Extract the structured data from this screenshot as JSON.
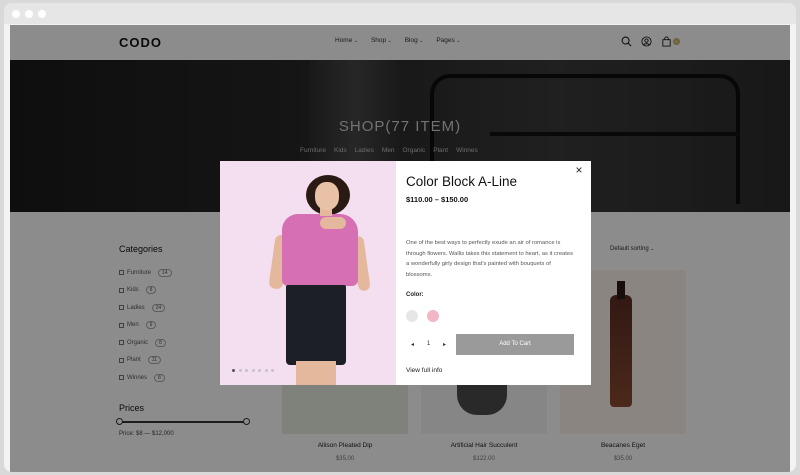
{
  "nav": {
    "logo": "CODO",
    "menu": [
      "Home",
      "Shop",
      "Blog",
      "Pages"
    ],
    "cart_count": "0",
    "icons": [
      "search-icon",
      "user-icon",
      "bag-icon"
    ]
  },
  "hero": {
    "title": "SHOP(77 ITEM)",
    "categories": [
      "Furniture",
      "Kids",
      "Ladies",
      "Men",
      "Organic",
      "Plant",
      "Winnes"
    ]
  },
  "sidebar": {
    "categories_title": "Categories",
    "categories": [
      {
        "label": "Furniture",
        "count": "14"
      },
      {
        "label": "Kids",
        "count": "8"
      },
      {
        "label": "Ladies",
        "count": "24"
      },
      {
        "label": "Men",
        "count": "9"
      },
      {
        "label": "Organic",
        "count": "8"
      },
      {
        "label": "Plant",
        "count": "11"
      },
      {
        "label": "Winnes",
        "count": "8"
      }
    ],
    "prices_title": "Prices",
    "price_range": "Price: $8 — $12,000"
  },
  "sort": {
    "selected": "Default sorting"
  },
  "products": [
    {
      "name": "Allison Pleated Dip",
      "price": "$35.00"
    },
    {
      "name": "Artificial Hair Succulent",
      "price": "$122.00"
    },
    {
      "name": "Beacanes Eget",
      "price": "$35.00"
    }
  ],
  "modal": {
    "title": "Color Block A-Line",
    "price": "$110.00 – $150.00",
    "description": "One of the best ways to perfectly exude an air of romance is through flowers. Wallis takes this statement to heart, as it creates a wonderfully girly design that's painted with bouquets of blossoms.",
    "color_label": "Color:",
    "swatches": [
      "#e6e6e6",
      "#f2b6c6"
    ],
    "quantity": "1",
    "add_to_cart": "Add To Cart",
    "view_full": "View full info",
    "close_glyph": "×",
    "slide_count": 7,
    "active_slide": 0
  }
}
